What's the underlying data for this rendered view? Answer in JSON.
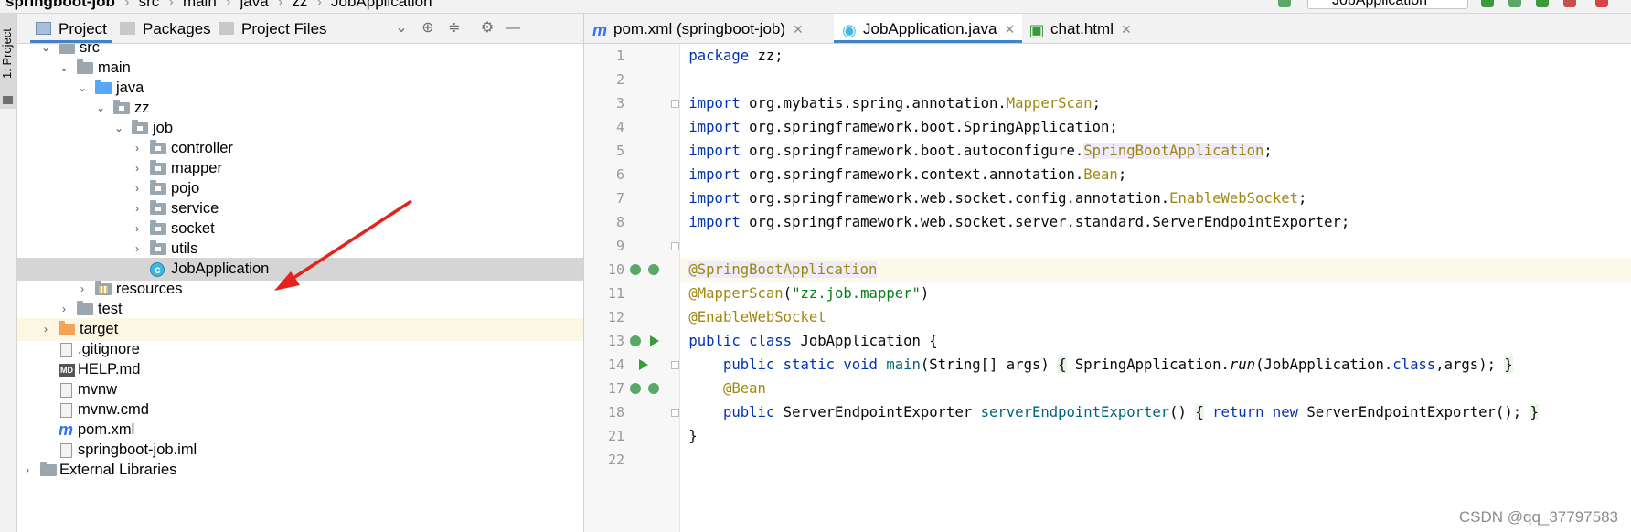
{
  "breadcrumb": {
    "project": "springboot-job",
    "items": [
      "src",
      "main",
      "java",
      "zz",
      "JobApplication"
    ],
    "run_config": "JobApplication"
  },
  "tool_strip": {
    "label": "1: Project"
  },
  "project_panel": {
    "tabs": [
      "Project",
      "Packages",
      "Project Files"
    ],
    "tree": [
      {
        "label": "src"
      },
      {
        "label": "main"
      },
      {
        "label": "java"
      },
      {
        "label": "zz"
      },
      {
        "label": "job"
      },
      {
        "label": "controller"
      },
      {
        "label": "mapper"
      },
      {
        "label": "pojo"
      },
      {
        "label": "service"
      },
      {
        "label": "socket"
      },
      {
        "label": "utils"
      },
      {
        "label": "JobApplication"
      },
      {
        "label": "resources"
      },
      {
        "label": "test"
      },
      {
        "label": "target"
      },
      {
        "label": ".gitignore"
      },
      {
        "label": "HELP.md"
      },
      {
        "label": "mvnw"
      },
      {
        "label": "mvnw.cmd"
      },
      {
        "label": "pom.xml"
      },
      {
        "label": "springboot-job.iml"
      },
      {
        "label": "External Libraries"
      }
    ]
  },
  "editor": {
    "tabs": [
      {
        "label": "pom.xml (springboot-job)",
        "icon": "maven-icon"
      },
      {
        "label": "JobApplication.java",
        "icon": "class-icon"
      },
      {
        "label": "chat.html",
        "icon": "html-icon"
      }
    ],
    "line_numbers": [
      "1",
      "2",
      "3",
      "4",
      "5",
      "6",
      "7",
      "8",
      "9",
      "10",
      "11",
      "12",
      "13",
      "14",
      "17",
      "18",
      "21",
      "22"
    ],
    "code": {
      "l1_kw": "package",
      "l1_rest": " zz;",
      "imp": "import",
      "l3_pre": " org.mybatis.spring.annotation.",
      "l3_ann": "MapperScan",
      "l3_end": ";",
      "l4": " org.springframework.boot.SpringApplication;",
      "l5_pre": " org.springframework.boot.autoconfigure.",
      "l5_ann": "SpringBootApplication",
      "l5_end": ";",
      "l6_pre": " org.springframework.context.annotation.",
      "l6_ann": "Bean",
      "l6_end": ";",
      "l7_pre": " org.springframework.web.socket.config.annotation.",
      "l7_ann": "EnableWebSocket",
      "l7_end": ";",
      "l8": " org.springframework.web.socket.server.standard.ServerEndpointExporter;",
      "l10_a": "@SpringBootApp",
      "l10_b": "lication",
      "l11_ann": "@MapperScan",
      "l11_open": "(",
      "l11_str": "\"zz.job.mapper\"",
      "l11_close": ")",
      "l12_ann": "@EnableWebSocket",
      "l13_kw": "public class",
      "l13_rest": " JobApplication {",
      "l14_kw": "public static void",
      "l14_fn": "main",
      "l14_args": "(String[] args) ",
      "l14_b1": "{",
      "l14_mid": " SpringApplication.",
      "l14_run": "run",
      "l14_call": "(JobApplication.",
      "l14_cls": "class",
      "l14_tail": ",args); ",
      "l14_b2": "}",
      "l17_ann": "@Bean",
      "l18_kw": "public",
      "l18_type": " ServerEndpointExporter ",
      "l18_fn": "serverEndpointExporter",
      "l18_paren": "() ",
      "l18_b1": "{",
      "l18_ret": "return",
      "l18_new": "new",
      "l18_tail": " ServerEndpointExporter(); ",
      "l18_b2": "}",
      "l21": "}"
    }
  },
  "watermark": "CSDN @qq_37797583"
}
